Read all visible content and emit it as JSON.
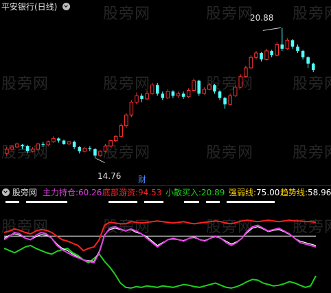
{
  "chart_title": "平安银行(日线)",
  "watermark": "股旁网",
  "price_labels": {
    "high": "20.88",
    "low": "14.76"
  },
  "cai_label": "财",
  "indicator": {
    "name": "股旁网",
    "items": [
      {
        "label": "主力持仓:",
        "value": "60.26",
        "color": "#e040e0"
      },
      {
        "label": "底部游资:",
        "value": "94.53",
        "color": "#ff2020"
      },
      {
        "label": "小散买入:",
        "value": "20.89",
        "color": "#20d020"
      },
      {
        "label": "强弱线:",
        "value": "75.00",
        "color": "#ffffff"
      },
      {
        "label": "趋势线:",
        "value": "58.96",
        "color": "#ffffff"
      }
    ]
  },
  "chart_data": {
    "type": "candlestick",
    "price_ylim": [
      14.2,
      21.6
    ],
    "candles": [
      [
        15.0,
        15.2,
        14.9,
        15.3
      ],
      [
        15.2,
        15.3,
        15.1,
        15.4
      ],
      [
        15.3,
        15.45,
        15.25,
        15.5
      ],
      [
        15.4,
        15.35,
        15.2,
        15.45
      ],
      [
        15.35,
        15.1,
        15.0,
        15.4
      ],
      [
        15.1,
        15.2,
        15.05,
        15.3
      ],
      [
        15.2,
        15.45,
        15.15,
        15.5
      ],
      [
        15.45,
        15.4,
        15.3,
        15.55
      ],
      [
        15.4,
        15.55,
        15.35,
        15.6
      ],
      [
        15.55,
        15.7,
        15.5,
        15.8
      ],
      [
        15.7,
        15.6,
        15.5,
        15.75
      ],
      [
        15.6,
        15.45,
        15.4,
        15.65
      ],
      [
        15.45,
        15.55,
        15.4,
        15.6
      ],
      [
        15.55,
        15.3,
        15.2,
        15.6
      ],
      [
        15.3,
        15.1,
        15.0,
        15.35
      ],
      [
        15.1,
        15.25,
        15.05,
        15.3
      ],
      [
        15.25,
        15.2,
        15.1,
        15.35
      ],
      [
        15.2,
        14.9,
        14.76,
        15.25
      ],
      [
        14.9,
        15.1,
        14.85,
        15.15
      ],
      [
        15.1,
        15.35,
        15.05,
        15.45
      ],
      [
        15.35,
        15.6,
        15.3,
        15.65
      ],
      [
        15.6,
        15.8,
        15.55,
        15.85
      ],
      [
        15.8,
        16.3,
        15.75,
        16.4
      ],
      [
        16.3,
        16.8,
        16.2,
        16.9
      ],
      [
        16.8,
        17.4,
        16.7,
        17.5
      ],
      [
        17.4,
        17.7,
        17.3,
        17.85
      ],
      [
        17.7,
        17.55,
        17.4,
        17.8
      ],
      [
        17.55,
        17.8,
        17.5,
        17.95
      ],
      [
        17.8,
        18.2,
        17.75,
        18.3
      ],
      [
        18.2,
        17.8,
        17.7,
        18.3
      ],
      [
        17.8,
        17.6,
        17.5,
        17.9
      ],
      [
        17.6,
        17.9,
        17.55,
        18.0
      ],
      [
        17.9,
        17.7,
        17.6,
        17.95
      ],
      [
        17.7,
        17.8,
        17.6,
        17.9
      ],
      [
        17.8,
        17.65,
        17.55,
        17.9
      ],
      [
        17.65,
        17.95,
        17.6,
        18.05
      ],
      [
        17.95,
        18.4,
        17.9,
        18.5
      ],
      [
        18.4,
        17.8,
        17.7,
        18.45
      ],
      [
        17.8,
        18.0,
        17.75,
        18.1
      ],
      [
        18.0,
        18.2,
        17.95,
        18.3
      ],
      [
        18.2,
        17.9,
        17.8,
        18.25
      ],
      [
        17.9,
        17.6,
        17.5,
        17.95
      ],
      [
        17.6,
        17.3,
        17.1,
        17.65
      ],
      [
        17.3,
        17.7,
        17.25,
        17.8
      ],
      [
        17.7,
        18.1,
        17.65,
        18.2
      ],
      [
        18.1,
        18.6,
        18.05,
        18.7
      ],
      [
        18.6,
        19.0,
        18.55,
        19.1
      ],
      [
        19.0,
        19.5,
        18.95,
        19.6
      ],
      [
        19.5,
        19.7,
        19.4,
        19.8
      ],
      [
        19.7,
        19.4,
        19.3,
        19.75
      ],
      [
        19.4,
        19.8,
        19.35,
        19.9
      ],
      [
        19.8,
        19.6,
        19.5,
        19.85
      ],
      [
        19.6,
        20.1,
        19.55,
        20.2
      ],
      [
        20.1,
        19.9,
        19.8,
        20.88
      ],
      [
        19.9,
        20.3,
        19.85,
        20.4
      ],
      [
        20.3,
        20.0,
        19.9,
        20.35
      ],
      [
        20.0,
        19.8,
        19.7,
        20.1
      ],
      [
        19.8,
        19.5,
        19.4,
        19.85
      ],
      [
        19.5,
        19.2,
        19.0,
        19.55
      ],
      [
        19.2,
        18.9,
        18.8,
        19.25
      ]
    ],
    "indicator_ylim": [
      0,
      120
    ],
    "lines": {
      "red": [
        80,
        82,
        85,
        83,
        80,
        78,
        82,
        84,
        83,
        80,
        75,
        70,
        68,
        65,
        62,
        55,
        58,
        60,
        70,
        90,
        94,
        93,
        92,
        92,
        95,
        94,
        93,
        94,
        95,
        96,
        95,
        94,
        93,
        94,
        95,
        93,
        92,
        93,
        94,
        95,
        96,
        95,
        93,
        92,
        94,
        96,
        97,
        96,
        95,
        96,
        97,
        96,
        95,
        96,
        97,
        96,
        96,
        95,
        95,
        94
      ],
      "magenta": [
        70,
        75,
        80,
        78,
        72,
        70,
        76,
        80,
        78,
        72,
        62,
        56,
        52,
        48,
        45,
        42,
        40,
        38,
        52,
        76,
        86,
        88,
        85,
        82,
        85,
        82,
        78,
        72,
        66,
        60,
        65,
        70,
        72,
        70,
        68,
        72,
        74,
        70,
        68,
        72,
        75,
        72,
        66,
        62,
        66,
        72,
        82,
        88,
        90,
        86,
        82,
        84,
        86,
        82,
        78,
        72,
        66,
        64,
        62,
        60
      ],
      "white": [
        72,
        76,
        78,
        76,
        72,
        70,
        74,
        77,
        76,
        72,
        64,
        58,
        55,
        50,
        46,
        42,
        41,
        40,
        54,
        77,
        84,
        86,
        84,
        82,
        84,
        80,
        78,
        74,
        68,
        62,
        66,
        70,
        71,
        70,
        69,
        72,
        73,
        70,
        69,
        72,
        74,
        72,
        68,
        64,
        67,
        72,
        80,
        86,
        88,
        85,
        81,
        83,
        84,
        81,
        77,
        72,
        68,
        66,
        64,
        62
      ],
      "green": [
        58,
        55,
        52,
        56,
        60,
        62,
        58,
        55,
        52,
        50,
        54,
        56,
        58,
        52,
        48,
        42,
        38,
        44,
        50,
        40,
        32,
        22,
        10,
        4,
        3,
        5,
        4,
        6,
        5,
        4,
        6,
        5,
        4,
        6,
        8,
        7,
        5,
        4,
        6,
        8,
        10,
        7,
        4,
        3,
        5,
        8,
        12,
        15,
        14,
        10,
        8,
        6,
        7,
        9,
        12,
        10,
        7,
        4,
        6,
        20
      ],
      "strong_weak_level": 75
    }
  }
}
